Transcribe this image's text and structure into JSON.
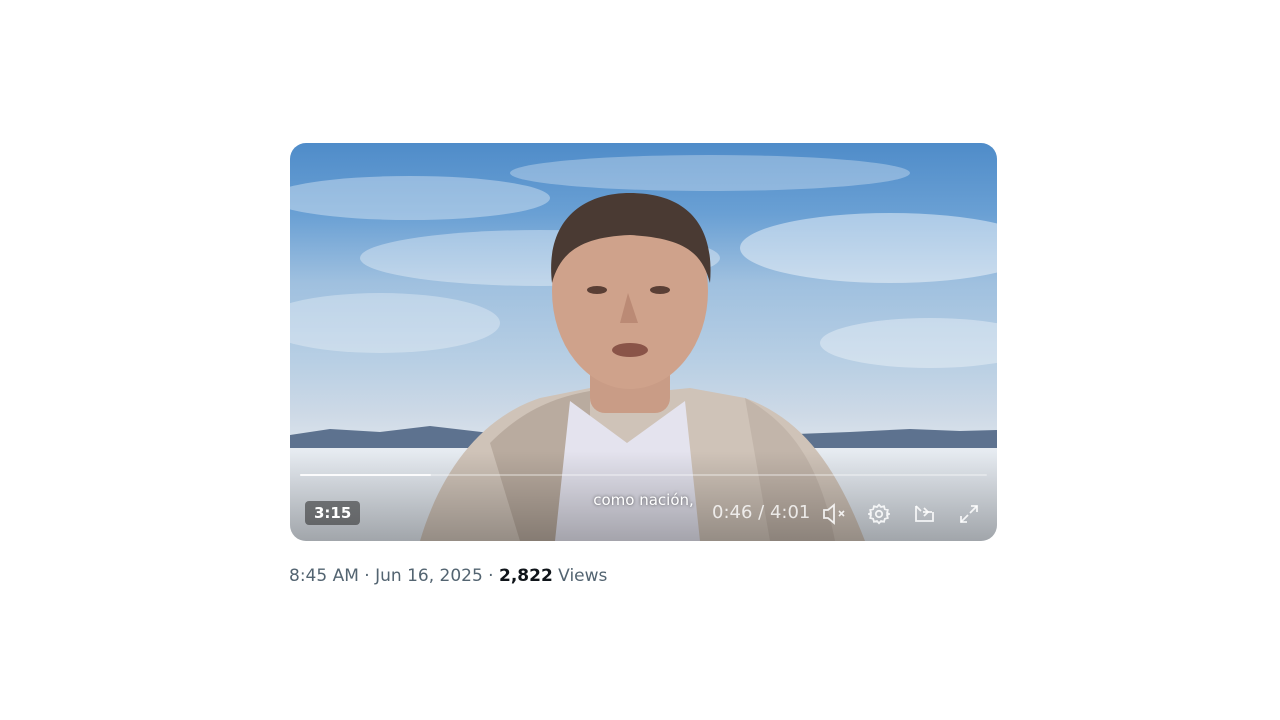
{
  "video": {
    "duration_badge": "3:15",
    "caption": "como nación,",
    "current_time": "0:46",
    "time_separator": " / ",
    "total_time": "4:01",
    "progress_fraction": 0.19,
    "controls": {
      "mute_icon": "speaker-muted-icon",
      "settings_icon": "gear-icon",
      "pip_icon": "picture-in-picture-icon",
      "fullscreen_icon": "expand-icon"
    }
  },
  "post_meta": {
    "time": "8:45 AM",
    "separator": " · ",
    "date": "Jun 16, 2025",
    "views_count": "2,822",
    "views_label": " Views"
  }
}
